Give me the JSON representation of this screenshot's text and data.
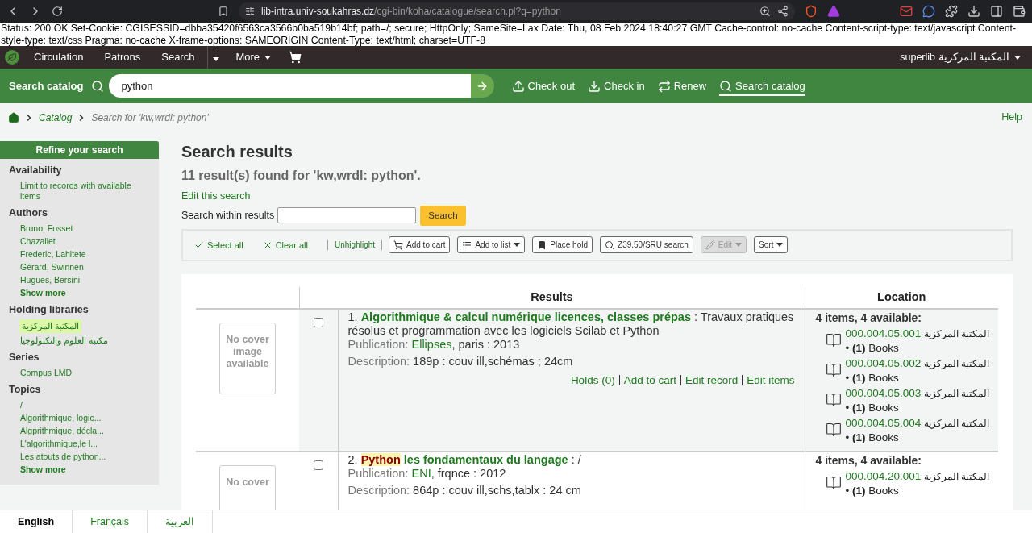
{
  "browser": {
    "url_host": "lib-intra.univ-soukahras.dz",
    "url_path": "/cgi-bin/koha/catalogue/search.pl?q=python"
  },
  "status_text": "Status: 200 OK Set-Cookie: CGISESSID=dbba35420f6563ca3566b0ba519b14bf; path=/; secure; HttpOnly; SameSite=Lax Date: Thu, 08 Feb 2024 18:40:27 GMT Cache-control: no-cache Content-script-type: text/javascript Content-style-type: text/css Pragma: no-cache X-frame-options: SAMEORIGIN Content-Type: text/html; charset=UTF-8",
  "nav": {
    "items": [
      "Circulation",
      "Patrons",
      "Search"
    ],
    "more": "More",
    "user": "superlib المكتبة المركزية"
  },
  "search_bar": {
    "label": "Search catalog",
    "value": "python",
    "actions": [
      {
        "kind": "checkout",
        "label": "Check out",
        "selected": false
      },
      {
        "kind": "checkin",
        "label": "Check in",
        "selected": false
      },
      {
        "kind": "renew",
        "label": "Renew",
        "selected": false
      },
      {
        "kind": "search",
        "label": "Search catalog",
        "selected": true
      }
    ]
  },
  "breadcrumb": {
    "items": [
      "Catalog",
      "Search for 'kw,wrdl: python'"
    ],
    "help": "Help"
  },
  "sidebar": {
    "title": "Refine your search",
    "groups": [
      {
        "title": "Availability",
        "items": [
          {
            "label": "Limit to records with available items",
            "selected": false
          }
        ]
      },
      {
        "title": "Authors",
        "items": [
          {
            "label": "Bruno, Fosset",
            "selected": false
          },
          {
            "label": "Chazallet",
            "selected": false
          },
          {
            "label": "Frederic, Lahitete",
            "selected": false
          },
          {
            "label": "Gérard, Swinnen",
            "selected": false
          },
          {
            "label": "Hugues, Bersini",
            "selected": false
          }
        ],
        "show_more": "Show more"
      },
      {
        "title": "Holding libraries",
        "items": [
          {
            "label": "المكتبة المركزية",
            "selected": true
          },
          {
            "label": "مكتبة العلوم والتكنولوجيا",
            "selected": false
          }
        ]
      },
      {
        "title": "Series",
        "items": [
          {
            "label": "Compus LMD",
            "selected": false
          }
        ]
      },
      {
        "title": "Topics",
        "items": [
          {
            "label": "/",
            "selected": false
          },
          {
            "label": "Algorithmique, logic...",
            "selected": false
          },
          {
            "label": "Algprithmique, décla...",
            "selected": false
          },
          {
            "label": "L'algorithmique,le l...",
            "selected": false
          },
          {
            "label": "Les atouts de python...",
            "selected": false
          }
        ],
        "show_more": "Show more"
      }
    ]
  },
  "main": {
    "title": "Search results",
    "summary": "11 result(s) found for 'kw,wrdl: python'.",
    "edit_link": "Edit this search",
    "within": {
      "label": "Search within results",
      "button": "Search"
    }
  },
  "toolbar": [
    {
      "kind": "select",
      "label": "Select all",
      "disabled": false
    },
    {
      "kind": "clear",
      "label": "Clear all",
      "disabled": false
    },
    {
      "kind": "unhighlight",
      "label": "Unhighlight",
      "disabled": false
    },
    {
      "kind": "cart",
      "label": "Add to cart",
      "disabled": false,
      "menu": false
    },
    {
      "kind": "list",
      "label": "Add to list",
      "disabled": false,
      "menu": true
    },
    {
      "kind": "hold",
      "label": "Place hold",
      "disabled": false,
      "menu": false
    },
    {
      "kind": "z3950",
      "label": "Z39.50/SRU search",
      "disabled": false,
      "menu": false
    },
    {
      "kind": "edit",
      "label": "Edit",
      "disabled": true,
      "menu": true
    },
    {
      "kind": "sort",
      "label": "Sort",
      "disabled": false,
      "menu": true
    }
  ],
  "table": {
    "columns": [
      "Results",
      "Location"
    ],
    "rows": [
      {
        "cover": "No cover image available",
        "checked": false,
        "number": "1.",
        "title": [
          {
            "text": "Algorithmique & calcul numérique licences, classes prépas",
            "highlighted": false
          }
        ],
        "subtitle": " : Travaux pratiques résolus et programmation avec les logiciels Scilab et Python",
        "publication": {
          "label": "Publication:",
          "publisher": "Ellipses",
          "rest": ", paris : 2013"
        },
        "description": {
          "label": "Description:",
          "value": "189p : couv ill,schémas ; 24cm"
        },
        "actions": [
          "Holds (0)",
          "Add to cart",
          "Edit record",
          "Edit items"
        ],
        "availability": "4 items, 4 available:",
        "items": [
          {
            "call_number": "000.004.05.001",
            "library": "المكتبة المركزية",
            "line": "• **(1)** Books"
          },
          {
            "call_number": "000.004.05.002",
            "library": "المكتبة المركزية",
            "line": "• **(1)** Books"
          },
          {
            "call_number": "000.004.05.003",
            "library": "المكتبة المركزية",
            "line": "• **(1)** Books"
          },
          {
            "call_number": "000.004.05.004",
            "library": "المكتبة المركزية",
            "line": "• **(1)** Books"
          }
        ]
      },
      {
        "cover": "No cover",
        "checked": false,
        "number": "2.",
        "title": [
          {
            "text": "Python",
            "highlighted": true
          },
          {
            "text": " les fondamentaux du langage",
            "highlighted": false
          }
        ],
        "subtitle": " : /",
        "publication": {
          "label": "Publication:",
          "publisher": "ENI",
          "rest": ", frqnce : 2012"
        },
        "description": {
          "label": "Description:",
          "value": "864p : couv ill,schs,tablx : 24 cm"
        },
        "availability": "4 items, 4 available:",
        "items": [
          {
            "call_number": "000.004.20.001",
            "library": "المكتبة المركزية",
            "line": "• **(1)** Books"
          }
        ]
      }
    ]
  },
  "languages": [
    {
      "label": "English",
      "selected": true
    },
    {
      "label": "Français",
      "selected": false
    },
    {
      "label": "العربية",
      "selected": false
    }
  ]
}
